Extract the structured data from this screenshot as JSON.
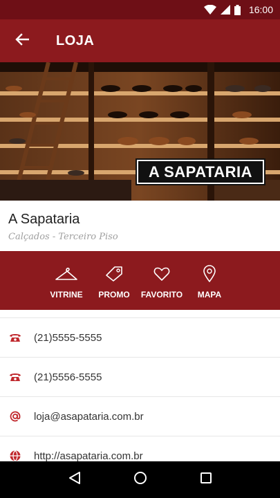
{
  "status_bar": {
    "time": "16:00",
    "icons": [
      "wifi-icon",
      "signal-icon",
      "battery-icon"
    ]
  },
  "app_bar": {
    "title": "LOJA",
    "back_icon": "arrow-left-icon"
  },
  "hero": {
    "logo_text": "A SAPATARIA"
  },
  "store": {
    "name": "A Sapataria",
    "subtitle": "Calçados - Terceiro Piso"
  },
  "actions": [
    {
      "label": "VITRINE",
      "icon": "hanger-icon"
    },
    {
      "label": "PROMO",
      "icon": "tag-icon"
    },
    {
      "label": "FAVORITO",
      "icon": "heart-icon"
    },
    {
      "label": "MAPA",
      "icon": "map-pin-icon"
    }
  ],
  "contacts": [
    {
      "text": "(21)5555-5555",
      "icon": "phone-icon"
    },
    {
      "text": "(21)5556-5555",
      "icon": "phone-icon"
    },
    {
      "text": "loja@asapataria.com.br",
      "icon": "at-icon"
    },
    {
      "text": "http://asapataria.com.br",
      "icon": "globe-icon"
    }
  ],
  "colors": {
    "primary": "#8c1a1e",
    "primary_dark": "#6e0f16",
    "accent_icon": "#c0282d"
  }
}
